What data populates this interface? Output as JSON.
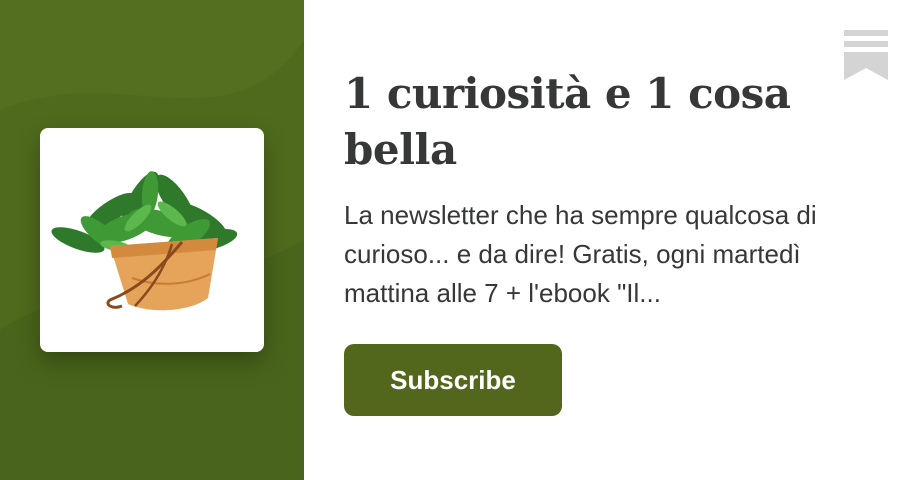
{
  "publication": {
    "title": "1 curiosità e 1 cosa bella",
    "description": "La newsletter che ha sempre qualcosa di curioso... e da dire! Gratis, ogni martedì mattina alle 7 + l'ebook \"Il..."
  },
  "subscribe": {
    "label": "Subscribe"
  },
  "icons": {
    "logo": "potted-plant-icon",
    "brand": "substack-bookmark-icon"
  },
  "colors": {
    "brand_green": "#4f6a1c",
    "button_green": "#52661c",
    "title_text": "#363737",
    "bookmark_grey": "#d4d4d4"
  }
}
